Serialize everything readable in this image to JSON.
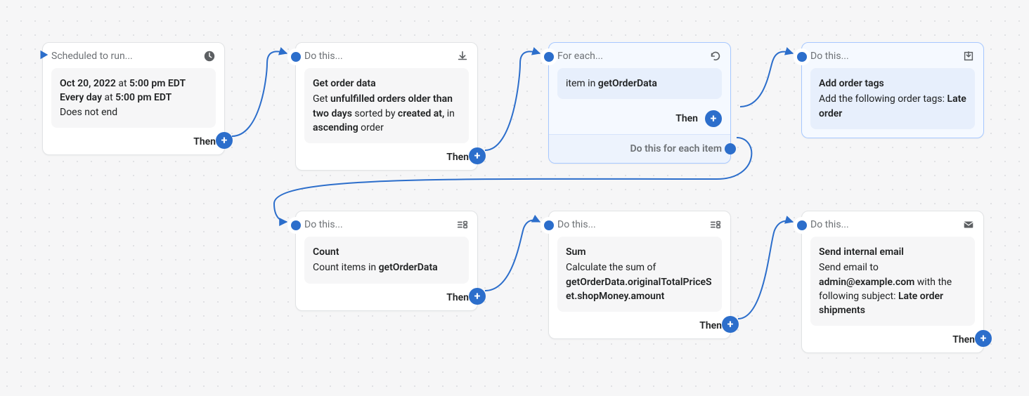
{
  "labels": {
    "then": "Then",
    "do_this": "Do this...",
    "scheduled": "Scheduled to run...",
    "for_each": "For each...",
    "do_each": "Do this for each item"
  },
  "cards": {
    "trigger": {
      "date": "Oct 20, 2022",
      "at1": " at ",
      "time1": "5:00 pm EDT",
      "repeat_prefix": "Every day",
      "at2": " at ",
      "time2": "5:00 pm EDT",
      "end": "Does not end"
    },
    "getOrder": {
      "title": "Get order data",
      "p1a": "Get ",
      "p1b": "unfulfilled orders older than two days",
      "p1c": " sorted by ",
      "p1d": "created at,",
      "p1e": " in ",
      "p1f": "ascending",
      "p1g": " order"
    },
    "foreach": {
      "item_prefix": "item in ",
      "item_var": "getOrderData"
    },
    "addTags": {
      "title": "Add order tags",
      "desc_a": "Add the following order tags: ",
      "desc_b": "Late order"
    },
    "count": {
      "title": "Count",
      "desc_a": "Count items in ",
      "desc_b": "getOrderData"
    },
    "sum": {
      "title": "Sum",
      "desc_a": "Calculate the sum of ",
      "desc_b": "getOrderData.originalTotalPriceSet.shopMoney.amount"
    },
    "email": {
      "title": "Send internal email",
      "desc_a": "Send email to ",
      "desc_b": "admin@example.com",
      "desc_c": " with the following subject: ",
      "desc_d": "Late order shipments"
    }
  }
}
